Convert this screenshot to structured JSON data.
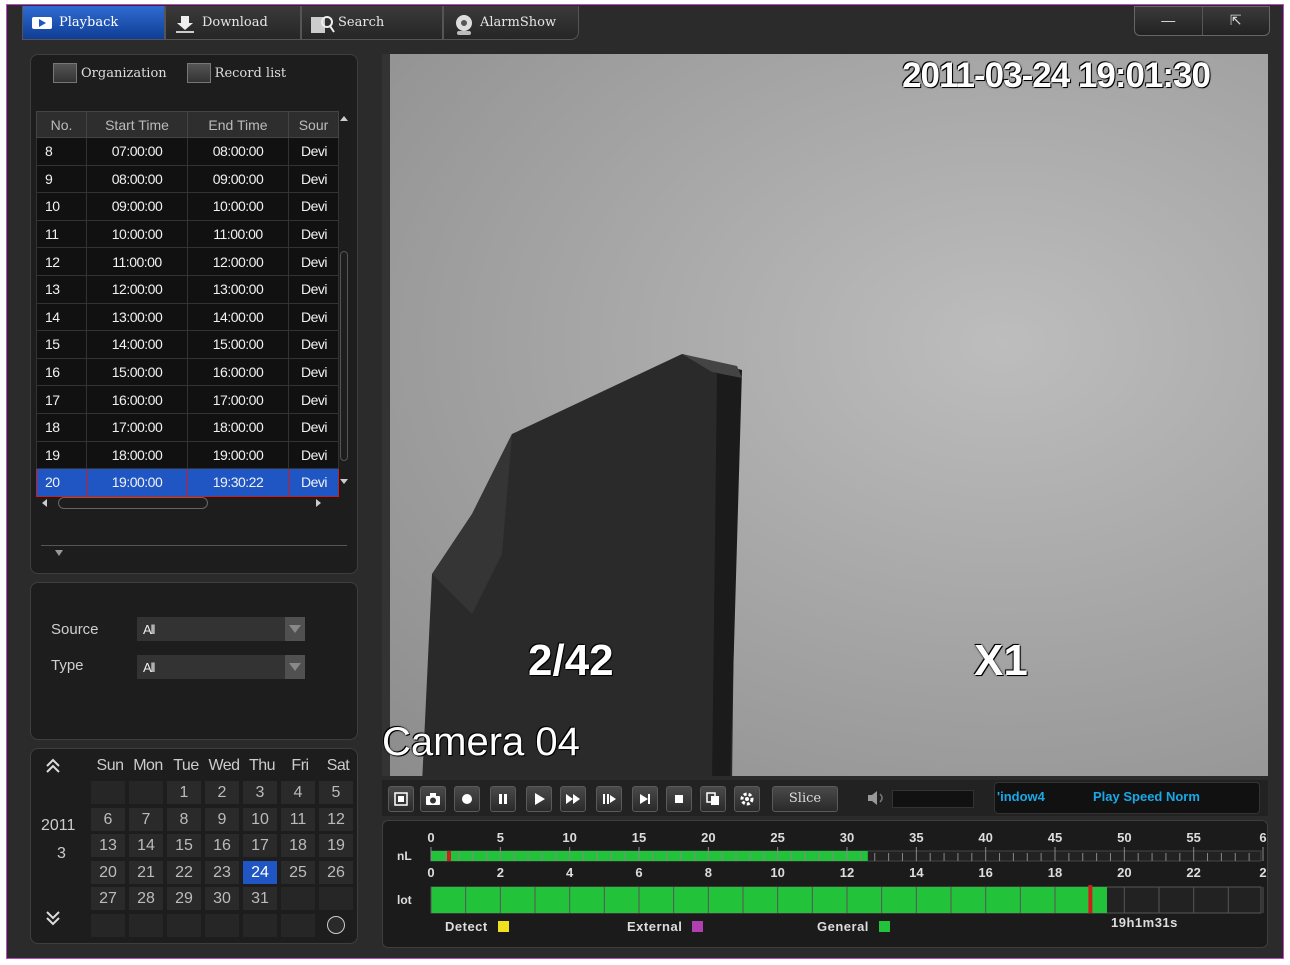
{
  "tabs": [
    {
      "label": "Playback",
      "icon": "playback-icon",
      "active": true
    },
    {
      "label": "Download",
      "icon": "download-icon",
      "active": false
    },
    {
      "label": "Search",
      "icon": "search-icon",
      "active": false
    },
    {
      "label": "AlarmShow",
      "icon": "alarm-icon",
      "active": false
    }
  ],
  "window": {
    "minimize": "—",
    "exit": "⇱"
  },
  "left": {
    "subtabs": [
      {
        "label": "Organization"
      },
      {
        "label": "Record list"
      }
    ],
    "table": {
      "columns": [
        "No.",
        "Start Time",
        "End Time",
        "Sour"
      ],
      "rows": [
        [
          "8",
          "07:00:00",
          "08:00:00",
          "Devi"
        ],
        [
          "9",
          "08:00:00",
          "09:00:00",
          "Devi"
        ],
        [
          "10",
          "09:00:00",
          "10:00:00",
          "Devi"
        ],
        [
          "11",
          "10:00:00",
          "11:00:00",
          "Devi"
        ],
        [
          "12",
          "11:00:00",
          "12:00:00",
          "Devi"
        ],
        [
          "13",
          "12:00:00",
          "13:00:00",
          "Devi"
        ],
        [
          "14",
          "13:00:00",
          "14:00:00",
          "Devi"
        ],
        [
          "15",
          "14:00:00",
          "15:00:00",
          "Devi"
        ],
        [
          "16",
          "15:00:00",
          "16:00:00",
          "Devi"
        ],
        [
          "17",
          "16:00:00",
          "17:00:00",
          "Devi"
        ],
        [
          "18",
          "17:00:00",
          "18:00:00",
          "Devi"
        ],
        [
          "19",
          "18:00:00",
          "19:00:00",
          "Devi"
        ],
        [
          "20",
          "19:00:00",
          "19:30:22",
          "Devi"
        ]
      ],
      "selected_row": "20"
    },
    "filters": {
      "source_label": "Source",
      "source_value": "All",
      "type_label": "Type",
      "type_value": "All"
    },
    "calendar": {
      "year": "2011",
      "month": "3",
      "weekdays": [
        "Sun",
        "Mon",
        "Tue",
        "Wed",
        "Thu",
        "Fri",
        "Sat"
      ],
      "weeks": [
        [
          "",
          "",
          "1",
          "2",
          "3",
          "4",
          "5"
        ],
        [
          "6",
          "7",
          "8",
          "9",
          "10",
          "11",
          "12"
        ],
        [
          "13",
          "14",
          "15",
          "16",
          "17",
          "18",
          "19"
        ],
        [
          "20",
          "21",
          "22",
          "23",
          "24",
          "25",
          "26"
        ],
        [
          "27",
          "28",
          "29",
          "30",
          "31",
          "",
          ""
        ],
        [
          "",
          "",
          "",
          "",
          "",
          "",
          ""
        ]
      ],
      "selected_day": "24"
    }
  },
  "video": {
    "timestamp": "2011-03-24 19:01:30",
    "frame_counter": "2/42",
    "speed": "X1",
    "camera_name": "Camera 04"
  },
  "controls": {
    "slice_label": "Slice",
    "window_label": "'indow4",
    "speed_label": "Play Speed Norm"
  },
  "timeline": {
    "top_side_label": "nL",
    "bottom_side_label": "lot",
    "minute_ticks": [
      "0",
      "5",
      "10",
      "15",
      "20",
      "25",
      "30",
      "35",
      "40",
      "45",
      "50",
      "55",
      "6"
    ],
    "hour_ticks": [
      "0",
      "2",
      "4",
      "6",
      "8",
      "10",
      "12",
      "14",
      "16",
      "18",
      "20",
      "22",
      "2"
    ],
    "minute_fill_minutes": 31.5,
    "hour_fill_hours": 19.5,
    "current_hour": 19.02,
    "duration": "19h1m31s",
    "legend": [
      {
        "label": "Detect",
        "color": "#f0e020"
      },
      {
        "label": "External",
        "color": "#b040b0"
      },
      {
        "label": "General",
        "color": "#22c33a"
      }
    ]
  }
}
